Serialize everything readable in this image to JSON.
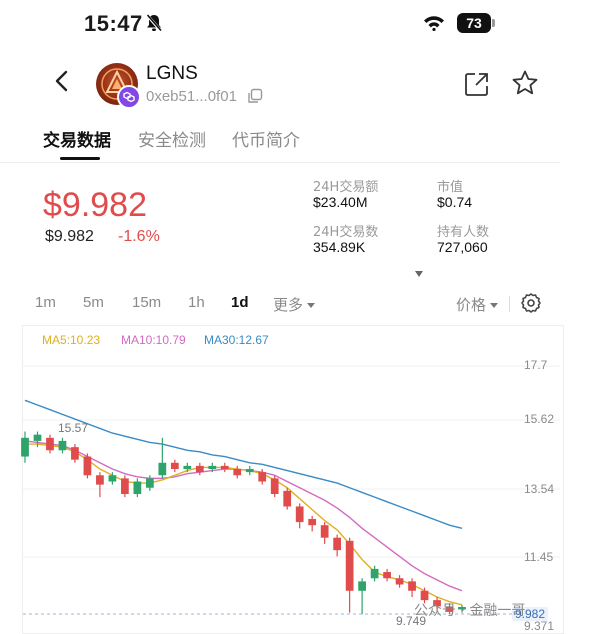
{
  "status": {
    "time": "15:47",
    "battery": "73"
  },
  "token": {
    "name": "LGNS",
    "address": "0xeb51...0f01"
  },
  "tabs": [
    {
      "label": "交易数据"
    },
    {
      "label": "安全检测"
    },
    {
      "label": "代币简介"
    }
  ],
  "price": {
    "main": "$9.982",
    "sub": "$9.982",
    "change": "-1.6%"
  },
  "stats": {
    "vol_label": "24H交易额",
    "vol_value": "$23.40M",
    "cap_label": "市值",
    "cap_value": "$0.74",
    "txn_label": "24H交易数",
    "txn_value": "354.89K",
    "holders_label": "持有人数",
    "holders_value": "727,060"
  },
  "timeframes": [
    {
      "label": "1m"
    },
    {
      "label": "5m"
    },
    {
      "label": "15m"
    },
    {
      "label": "1h"
    },
    {
      "label": "1d"
    },
    {
      "label": "更多"
    }
  ],
  "price_toggle": "价格",
  "ma": {
    "ma5": "MA5:10.23",
    "ma10": "MA10:10.79",
    "ma30": "MA30:12.67"
  },
  "colors": {
    "up": "#2ea36a",
    "down": "#e04c4c",
    "ma5": "#e0b020",
    "ma10": "#d26bc2",
    "ma30": "#3a8bc4"
  },
  "chart_data": {
    "type": "line",
    "title": "",
    "y_ticks": [
      17.7,
      15.62,
      13.54,
      11.45,
      9.371
    ],
    "ylim": [
      9.371,
      17.7
    ],
    "annotations": {
      "high": "15.57",
      "low": "9.749",
      "current": "9.982",
      "bottom": "9.371"
    },
    "candles": [
      {
        "o": 14.8,
        "c": 15.4,
        "h": 15.6,
        "l": 14.6
      },
      {
        "o": 15.3,
        "c": 15.5,
        "h": 15.6,
        "l": 15.1
      },
      {
        "o": 15.4,
        "c": 15.0,
        "h": 15.5,
        "l": 14.9
      },
      {
        "o": 15.0,
        "c": 15.3,
        "h": 15.4,
        "l": 14.9
      },
      {
        "o": 15.1,
        "c": 14.7,
        "h": 15.2,
        "l": 14.6
      },
      {
        "o": 14.8,
        "c": 14.2,
        "h": 14.9,
        "l": 14.1
      },
      {
        "o": 14.2,
        "c": 13.9,
        "h": 14.3,
        "l": 13.5
      },
      {
        "o": 14.0,
        "c": 14.2,
        "h": 14.3,
        "l": 13.9
      },
      {
        "o": 14.1,
        "c": 13.6,
        "h": 14.2,
        "l": 13.5
      },
      {
        "o": 13.6,
        "c": 14.0,
        "h": 14.1,
        "l": 13.5
      },
      {
        "o": 13.8,
        "c": 14.1,
        "h": 14.2,
        "l": 13.7
      },
      {
        "o": 14.2,
        "c": 14.6,
        "h": 15.4,
        "l": 14.1
      },
      {
        "o": 14.6,
        "c": 14.4,
        "h": 14.7,
        "l": 14.3
      },
      {
        "o": 14.4,
        "c": 14.5,
        "h": 14.6,
        "l": 14.3
      },
      {
        "o": 14.5,
        "c": 14.3,
        "h": 14.6,
        "l": 14.2
      },
      {
        "o": 14.4,
        "c": 14.5,
        "h": 14.6,
        "l": 14.3
      },
      {
        "o": 14.5,
        "c": 14.4,
        "h": 14.6,
        "l": 14.3
      },
      {
        "o": 14.4,
        "c": 14.2,
        "h": 14.5,
        "l": 14.1
      },
      {
        "o": 14.3,
        "c": 14.4,
        "h": 14.5,
        "l": 14.2
      },
      {
        "o": 14.3,
        "c": 14.0,
        "h": 14.4,
        "l": 13.9
      },
      {
        "o": 14.1,
        "c": 13.6,
        "h": 14.2,
        "l": 13.5
      },
      {
        "o": 13.7,
        "c": 13.2,
        "h": 13.8,
        "l": 13.1
      },
      {
        "o": 13.2,
        "c": 12.7,
        "h": 13.3,
        "l": 12.5
      },
      {
        "o": 12.8,
        "c": 12.6,
        "h": 12.9,
        "l": 12.4
      },
      {
        "o": 12.6,
        "c": 12.2,
        "h": 12.7,
        "l": 12.0
      },
      {
        "o": 12.2,
        "c": 11.8,
        "h": 12.3,
        "l": 11.6
      },
      {
        "o": 12.1,
        "c": 10.5,
        "h": 12.2,
        "l": 9.8
      },
      {
        "o": 10.5,
        "c": 10.8,
        "h": 10.9,
        "l": 9.75
      },
      {
        "o": 10.9,
        "c": 11.2,
        "h": 11.3,
        "l": 10.8
      },
      {
        "o": 11.1,
        "c": 10.9,
        "h": 11.2,
        "l": 10.8
      },
      {
        "o": 10.9,
        "c": 10.7,
        "h": 11.0,
        "l": 10.6
      },
      {
        "o": 10.8,
        "c": 10.5,
        "h": 10.9,
        "l": 10.3
      },
      {
        "o": 10.5,
        "c": 10.2,
        "h": 10.6,
        "l": 10.1
      },
      {
        "o": 10.2,
        "c": 10.0,
        "h": 10.3,
        "l": 9.9
      },
      {
        "o": 10.0,
        "c": 9.85,
        "h": 10.1,
        "l": 9.75
      },
      {
        "o": 9.9,
        "c": 9.98,
        "h": 10.05,
        "l": 9.8
      }
    ],
    "ma30": [
      16.6,
      16.45,
      16.3,
      16.15,
      16.0,
      15.85,
      15.7,
      15.55,
      15.45,
      15.35,
      15.25,
      15.2,
      15.1,
      15.0,
      14.95,
      14.85,
      14.8,
      14.7,
      14.6,
      14.55,
      14.45,
      14.35,
      14.25,
      14.15,
      14.05,
      13.95,
      13.8,
      13.65,
      13.5,
      13.35,
      13.2,
      13.05,
      12.9,
      12.75,
      12.6,
      12.5
    ],
    "ma10": [
      15.3,
      15.25,
      15.2,
      15.15,
      15.0,
      14.8,
      14.6,
      14.4,
      14.25,
      14.15,
      14.1,
      14.1,
      14.15,
      14.25,
      14.3,
      14.35,
      14.4,
      14.4,
      14.35,
      14.3,
      14.2,
      14.0,
      13.8,
      13.6,
      13.4,
      13.15,
      12.85,
      12.5,
      12.2,
      11.9,
      11.6,
      11.3,
      11.05,
      10.85,
      10.65,
      10.5
    ],
    "ma5": [
      15.2,
      15.2,
      15.15,
      15.1,
      14.95,
      14.7,
      14.4,
      14.2,
      14.0,
      13.95,
      13.95,
      14.05,
      14.2,
      14.35,
      14.45,
      14.45,
      14.45,
      14.4,
      14.35,
      14.25,
      14.05,
      13.8,
      13.45,
      13.1,
      12.75,
      12.45,
      12.0,
      11.5,
      11.1,
      10.95,
      10.85,
      10.7,
      10.5,
      10.3,
      10.15,
      10.05
    ]
  },
  "watermark": "公众号 · 金融一哥"
}
